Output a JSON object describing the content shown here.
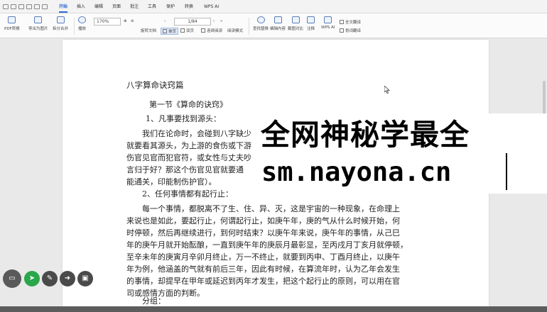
{
  "menubar": {
    "tabs": [
      {
        "label": "开始",
        "active": true
      },
      {
        "label": "插入"
      },
      {
        "label": "编辑"
      },
      {
        "label": "页面"
      },
      {
        "label": "批注"
      },
      {
        "label": "工具"
      },
      {
        "label": "保护"
      },
      {
        "label": "转换"
      },
      {
        "label": "WPS AI"
      }
    ]
  },
  "ribbon": {
    "pdf_convert": "PDF转换",
    "export_image": "导出为图片",
    "split_merge": "拆分合并",
    "settings": "播放",
    "zoom_value": "170%",
    "rotate_doc": "旋转文档",
    "single_page": "单页",
    "double_page": "双页",
    "continuous": "连续阅读",
    "read_mode": "阅读模式",
    "page_value": "1/84",
    "find_replace": "查找替换",
    "edit_content": "编辑内容",
    "capture_compare": "截图对比",
    "annotate": "注释",
    "wps_ai": "WPS AI",
    "translate_full": "全文翻译",
    "translate_select": "划词翻译",
    "accent": "#2a6bd1"
  },
  "doc": {
    "title": "八字算命诀窍篇",
    "section": "第一节《算命的诀窍》",
    "item1": "1、凡事要找到源头：",
    "p1": [
      "我们在论命时，会碰到八字缺少",
      "就要看其源头，为上游的食伤或下游",
      "伤官见官而犯官符，或女性与丈夫吵",
      "言归于好？那这个伤官见官就要通",
      "能通关，印能制伤护官）。"
    ],
    "item2": "2、任何事情都有起行止：",
    "p2": [
      "每一个事情，都脱离不了生、住、异、灭，这是宇宙的一种现象，在命理上",
      "来说也是如此，要起行止，何谓起行止，如庚午年，庚的气从什么时候开始，何",
      "时停顿，然后再继续进行，到何时结束？以庚午年来说，庚午年的事情，从己巳",
      "年的庚午月就开始酝酿，一直到庚午年的庚辰月最彰显，至丙戌月丁亥月就停顿，",
      "至辛未年的庚寅月辛卯月终止，万一不终止，就要到丙申、丁酉月终止，以庚午",
      "年为例，他涵盖的气就有前后三年，因此有时候，在算流年时，认为乙年会发生",
      "的事情，却提早在甲年或延迟到丙年才发生，把这个起行止的原则，可以用在官",
      "司或感情方面的判断。"
    ],
    "item3": "分组："
  },
  "watermark": {
    "line1": "全网神秘学最全",
    "line2": "sm.nayona.cn"
  },
  "floating_toolbar": {
    "icons": [
      "keyboard-icon",
      "cursor-icon",
      "pen-icon",
      "arrow-icon",
      "image-icon"
    ]
  }
}
